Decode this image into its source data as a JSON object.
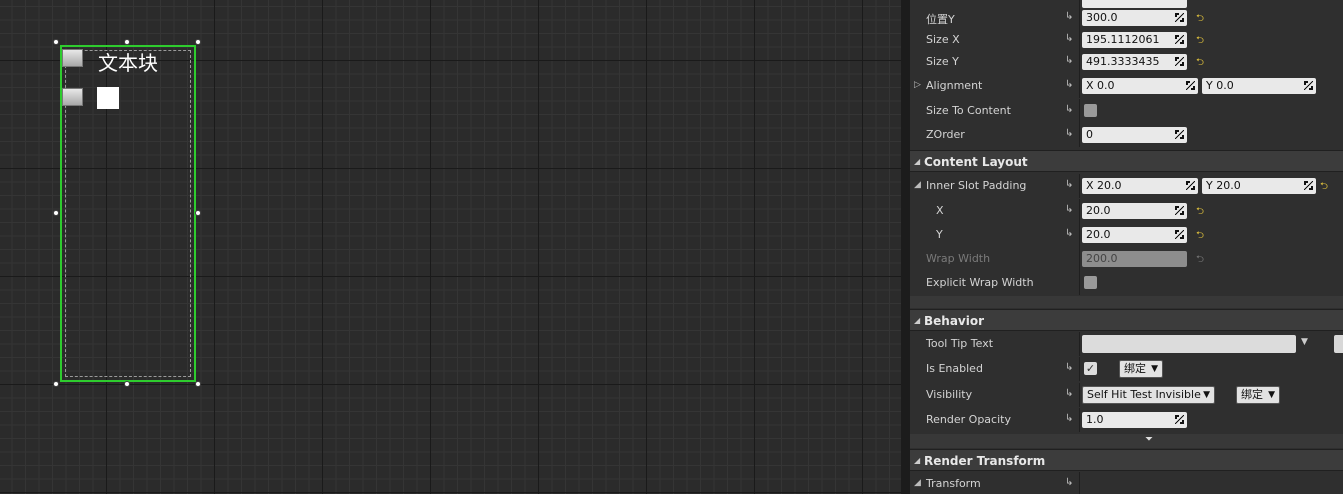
{
  "canvas": {
    "text_block_label": "文本块"
  },
  "details": {
    "rows_top": [
      {
        "label": "位置Y",
        "value": "300.0"
      },
      {
        "label": "Size X",
        "value": "195.1112061"
      },
      {
        "label": "Size Y",
        "value": "491.3333435"
      }
    ],
    "alignment": {
      "label": "Alignment",
      "x": "X  0.0",
      "y": "Y  0.0"
    },
    "size_to_content": {
      "label": "Size To Content"
    },
    "zorder": {
      "label": "ZOrder",
      "value": "0"
    },
    "content_layout": {
      "title": "Content Layout",
      "inner_slot_padding": {
        "label": "Inner Slot Padding",
        "x": "X  20.0",
        "y": "Y  20.0"
      },
      "x": {
        "label": "X",
        "value": "20.0"
      },
      "y": {
        "label": "Y",
        "value": "20.0"
      },
      "wrap_width": {
        "label": "Wrap Width",
        "value": "200.0"
      },
      "explicit_wrap_width": {
        "label": "Explicit Wrap Width"
      }
    },
    "behavior": {
      "title": "Behavior",
      "tooltip": {
        "label": "Tool Tip Text",
        "value": ""
      },
      "is_enabled": {
        "label": "Is Enabled",
        "bind": "绑定"
      },
      "visibility": {
        "label": "Visibility",
        "value": "Self Hit Test Invisible",
        "bind": "绑定"
      },
      "render_opacity": {
        "label": "Render Opacity",
        "value": "1.0"
      }
    },
    "render_transform": {
      "title": "Render Transform",
      "transform": {
        "label": "Transform"
      }
    }
  },
  "colors": {
    "selection": "#2ecc2e",
    "reset_arrow": "#e0c23c"
  }
}
